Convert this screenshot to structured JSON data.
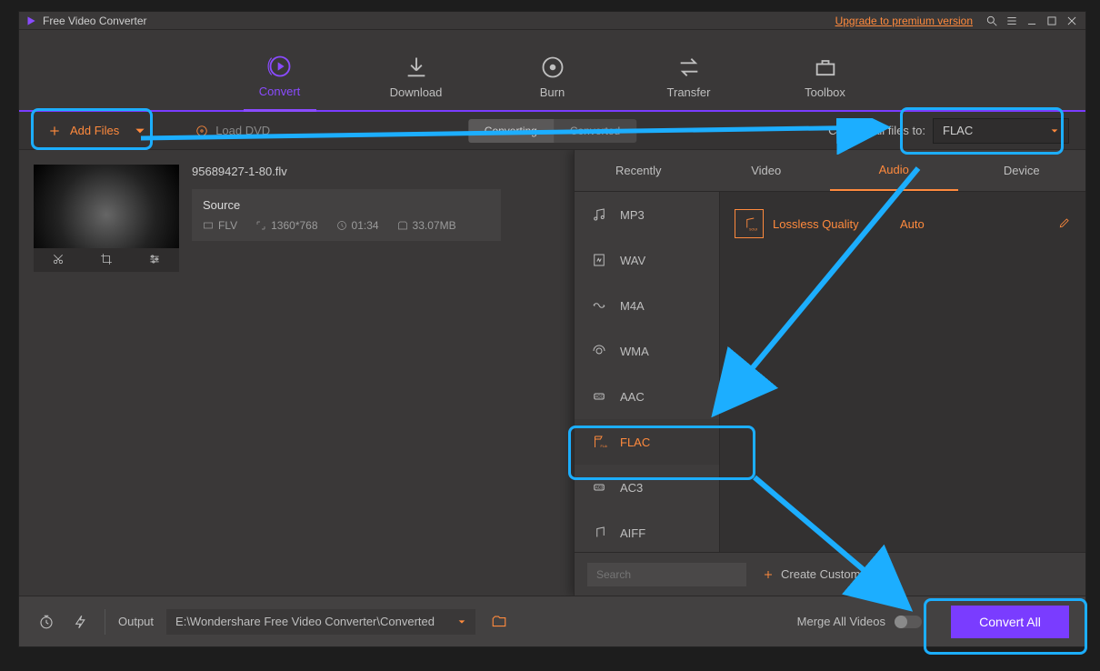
{
  "app": {
    "title": "Free Video Converter",
    "premium_link": "Upgrade to premium version"
  },
  "main_tabs": {
    "convert": "Convert",
    "download": "Download",
    "burn": "Burn",
    "transfer": "Transfer",
    "toolbox": "Toolbox"
  },
  "toolbar": {
    "add_files": "Add Files",
    "load_dvd": "Load DVD",
    "seg_converting": "Converting",
    "seg_converted": "Converted",
    "convert_all_label": "Convert all files to:",
    "format_selected": "FLAC"
  },
  "file": {
    "name": "95689427-1-80.flv",
    "source_label": "Source",
    "codec": "FLV",
    "resolution": "1360*768",
    "duration": "01:34",
    "size": "33.07MB"
  },
  "popup": {
    "tabs": {
      "recently": "Recently",
      "video": "Video",
      "audio": "Audio",
      "device": "Device"
    },
    "formats": [
      "MP3",
      "WAV",
      "M4A",
      "WMA",
      "AAC",
      "FLAC",
      "AC3",
      "AIFF"
    ],
    "selected_format": "FLAC",
    "quality_label": "Lossless Quality",
    "quality_value": "Auto",
    "search_placeholder": "Search",
    "create_custom": "Create Custom"
  },
  "bottom": {
    "output_label": "Output",
    "output_path": "E:\\Wondershare Free Video Converter\\Converted",
    "merge_label": "Merge All Videos",
    "convert_all": "Convert All"
  }
}
